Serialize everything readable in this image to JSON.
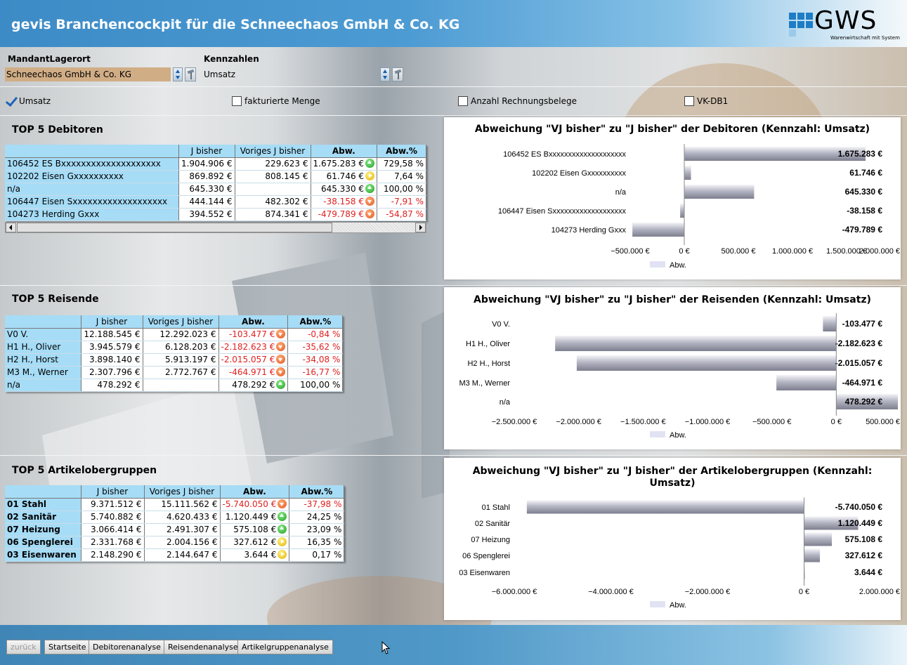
{
  "header": {
    "title": "gevis Branchencockpit für die Schneechaos GmbH & Co. KG"
  },
  "logo": {
    "text": "GWS",
    "tagline": "Warenwirtschaft mit System"
  },
  "filters": {
    "mandant_label": "MandantLagerort",
    "mandant_value": "Schneechaos GmbH & Co. KG",
    "kennzahlen_label": "Kennzahlen",
    "kennzahlen_value": "Umsatz"
  },
  "checkboxes": [
    {
      "label": "Umsatz",
      "checked": true
    },
    {
      "label": "fakturierte Menge",
      "checked": false
    },
    {
      "label": "Anzahl Rechnungsbelege",
      "checked": false
    },
    {
      "label": "VK-DB1",
      "checked": false
    }
  ],
  "sections": [
    {
      "title": "TOP 5 Debitoren",
      "columns": [
        "",
        "J bisher",
        "Voriges J bisher",
        "Abw.",
        "Abw.%"
      ],
      "rows": [
        {
          "name": "106452 ES Bxxxxxxxxxxxxxxxxxxxx",
          "j": "1.904.906 €",
          "vj": "229.623 €",
          "abw": "1.675.283 €",
          "trend": "up",
          "pct": "729,58 %"
        },
        {
          "name": "102202 Eisen Gxxxxxxxxxx",
          "j": "869.892 €",
          "vj": "808.145 €",
          "abw": "61.746 €",
          "trend": "right",
          "pct": "7,64 %"
        },
        {
          "name": "n/a",
          "j": "645.330 €",
          "vj": "",
          "abw": "645.330 €",
          "trend": "up",
          "pct": "100,00 %"
        },
        {
          "name": "106447 Eisen Sxxxxxxxxxxxxxxxxxxx",
          "j": "444.144 €",
          "vj": "482.302 €",
          "abw": "-38.158 €",
          "trend": "down",
          "pct": "-7,91 %"
        },
        {
          "name": "104273 Herding Gxxx",
          "j": "394.552 €",
          "vj": "874.341 €",
          "abw": "-479.789 €",
          "trend": "down",
          "pct": "-54,87 %"
        }
      ]
    },
    {
      "title": "TOP 5 Reisende",
      "columns": [
        "",
        "J bisher",
        "Voriges J bisher",
        "Abw.",
        "Abw.%"
      ],
      "rows": [
        {
          "name": "V0 V.",
          "j": "12.188.545 €",
          "vj": "12.292.023 €",
          "abw": "-103.477 €",
          "trend": "down",
          "pct": "-0,84 %"
        },
        {
          "name": "H1 H., Oliver",
          "j": "3.945.579 €",
          "vj": "6.128.203 €",
          "abw": "-2.182.623 €",
          "trend": "down",
          "pct": "-35,62 %"
        },
        {
          "name": "H2 H., Horst",
          "j": "3.898.140 €",
          "vj": "5.913.197 €",
          "abw": "-2.015.057 €",
          "trend": "down",
          "pct": "-34,08 %"
        },
        {
          "name": "M3 M., Werner",
          "j": "2.307.796 €",
          "vj": "2.772.767 €",
          "abw": "-464.971 €",
          "trend": "down",
          "pct": "-16,77 %"
        },
        {
          "name": "n/a",
          "j": "478.292 €",
          "vj": "",
          "abw": "478.292 €",
          "trend": "up",
          "pct": "100,00 %"
        }
      ]
    },
    {
      "title": "TOP 5 Artikelobergruppen",
      "columns": [
        "",
        "J bisher",
        "Voriges J bisher",
        "Abw.",
        "Abw.%"
      ],
      "rows": [
        {
          "name": "01 Stahl",
          "j": "9.371.512 €",
          "vj": "15.111.562 €",
          "abw": "-5.740.050 €",
          "trend": "down",
          "pct": "-37,98 %"
        },
        {
          "name": "02 Sanitär",
          "j": "5.740.882 €",
          "vj": "4.620.433 €",
          "abw": "1.120.449 €",
          "trend": "up",
          "pct": "24,25 %"
        },
        {
          "name": "07 Heizung",
          "j": "3.066.414 €",
          "vj": "2.491.307 €",
          "abw": "575.108 €",
          "trend": "up",
          "pct": "23,09 %"
        },
        {
          "name": "06 Spenglerei",
          "j": "2.331.768 €",
          "vj": "2.004.156 €",
          "abw": "327.612 €",
          "trend": "right",
          "pct": "16,35 %"
        },
        {
          "name": "03 Eisenwaren",
          "j": "2.148.290 €",
          "vj": "2.144.647 €",
          "abw": "3.644 €",
          "trend": "right",
          "pct": "0,17 %"
        }
      ]
    }
  ],
  "chart_data": [
    {
      "type": "bar",
      "orientation": "horizontal",
      "title": "Abweichung \"VJ bisher\" zu \"J bisher\" der Debitoren (Kennzahl: Umsatz)",
      "categories": [
        "106452 ES Bxxxxxxxxxxxxxxxxxxxx",
        "102202 Eisen Gxxxxxxxxxx",
        "n/a",
        "106447 Eisen Sxxxxxxxxxxxxxxxxxxx",
        "104273 Herding Gxxx"
      ],
      "series": [
        {
          "name": "Abw.",
          "values": [
            1675283,
            61746,
            645330,
            -38158,
            -479789
          ]
        }
      ],
      "value_labels": [
        "1.675.283 €",
        "61.746 €",
        "645.330 €",
        "-38.158 €",
        "-479.789 €"
      ],
      "xlim": [
        -500000,
        2000000
      ],
      "ticks": [
        -500000,
        0,
        500000,
        1000000,
        1500000,
        2000000
      ],
      "tick_labels": [
        "−500.000 €",
        "0 €",
        "500.000 €",
        "1.000.000 €",
        "1.500.000 €",
        "2.000.000 €"
      ],
      "legend": "bottom"
    },
    {
      "type": "bar",
      "orientation": "horizontal",
      "title": "Abweichung \"VJ bisher\" zu \"J bisher\" der Reisenden (Kennzahl: Umsatz)",
      "categories": [
        "V0 V.",
        "H1 H., Oliver",
        "H2 H., Horst",
        "M3 M., Werner",
        "n/a"
      ],
      "series": [
        {
          "name": "Abw.",
          "values": [
            -103477,
            -2182623,
            -2015057,
            -464971,
            478292
          ]
        }
      ],
      "value_labels": [
        "-103.477 €",
        "-2.182.623 €",
        "-2.015.057 €",
        "-464.971 €",
        "478.292 €"
      ],
      "xlim": [
        -2500000,
        500000
      ],
      "ticks": [
        -2500000,
        -2000000,
        -1500000,
        -1000000,
        -500000,
        0,
        500000
      ],
      "tick_labels": [
        "−2.500.000 €",
        "−2.000.000 €",
        "−1.500.000 €",
        "−1.000.000 €",
        "−500.000 €",
        "0 €",
        "500.000 €"
      ],
      "legend": "bottom"
    },
    {
      "type": "bar",
      "orientation": "horizontal",
      "title": "Abweichung \"VJ bisher\" zu \"J bisher\" der Artikelobergruppen (Kennzahl: Umsatz)",
      "categories": [
        "01 Stahl",
        "02 Sanitär",
        "07 Heizung",
        "06 Spenglerei",
        "03 Eisenwaren"
      ],
      "series": [
        {
          "name": "Abw.",
          "values": [
            -5740050,
            1120449,
            575108,
            327612,
            3644
          ]
        }
      ],
      "value_labels": [
        "-5.740.050 €",
        "1.120.449 €",
        "575.108 €",
        "327.612 €",
        "3.644 €"
      ],
      "xlim": [
        -6000000,
        2000000
      ],
      "ticks": [
        -6000000,
        -4000000,
        -2000000,
        0,
        2000000
      ],
      "tick_labels": [
        "−6.000.000 €",
        "−4.000.000 €",
        "−2.000.000 €",
        "0 €",
        "2.000.000 €"
      ],
      "legend": "bottom"
    }
  ],
  "footer": {
    "buttons": [
      {
        "label": "zurück",
        "disabled": true
      },
      {
        "label": "Startseite",
        "disabled": false
      },
      {
        "label": "Debitorenanalyse",
        "disabled": false
      },
      {
        "label": "Reisendenanalyse",
        "disabled": false
      },
      {
        "label": "Artikelgruppenanalyse",
        "disabled": false
      }
    ]
  }
}
